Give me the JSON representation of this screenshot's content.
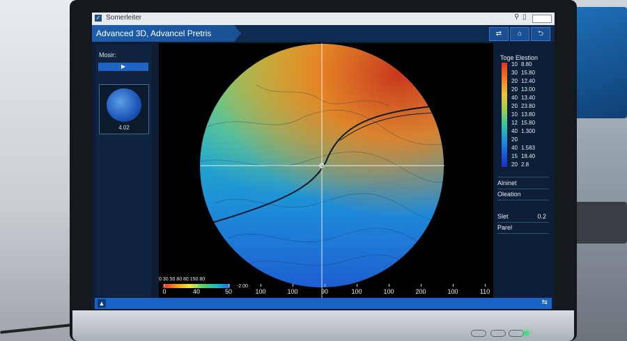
{
  "window": {
    "title": "Somerleiter",
    "app_title": "Advanced 3D, Advancel Pretris",
    "title_controls": [
      "⚲",
      "▯"
    ],
    "header_buttons": [
      "⇄",
      "⌂",
      "⮌"
    ]
  },
  "left_panel": {
    "label": "Mosir:",
    "play_label": "▶",
    "thumbnail_caption": "4.02"
  },
  "scale_legend": {
    "labels": "0   30   50   80   80   150  80",
    "right_value": "-2.00"
  },
  "x_axis": {
    "ticks": [
      "0",
      "40",
      "50",
      "100",
      "100",
      "90",
      "100",
      "100",
      "200",
      "100",
      "110"
    ]
  },
  "legend": {
    "title": "Toge Elestion",
    "rows": [
      {
        "a": "10",
        "b": "8.80"
      },
      {
        "a": "30",
        "b": "15.80"
      },
      {
        "a": "20",
        "b": "12.40"
      },
      {
        "a": "20",
        "b": "13.00"
      },
      {
        "a": "40",
        "b": "13.40"
      },
      {
        "a": "20",
        "b": "23.80"
      },
      {
        "a": "10",
        "b": "13.80"
      },
      {
        "a": "12",
        "b": "15.80"
      },
      {
        "a": "40",
        "b": "1.300"
      },
      {
        "a": "20",
        "b": ""
      },
      {
        "a": "40",
        "b": "1.583"
      },
      {
        "a": "15",
        "b": "18.40"
      },
      {
        "a": "20",
        "b": "2.8"
      }
    ],
    "colors": [
      "#e0361b",
      "#f57a22",
      "#f0c23a",
      "#9ed24a",
      "#33c4a8",
      "#1b8fe0",
      "#1b2fc2"
    ]
  },
  "right_panel": {
    "item1": "Alninet",
    "item2": "Oleation",
    "slet_label": "Slet",
    "slet_value": "0.2",
    "panel_label": "Parel"
  },
  "status": {
    "left_icon": "▲",
    "right_icon": "⇆"
  }
}
